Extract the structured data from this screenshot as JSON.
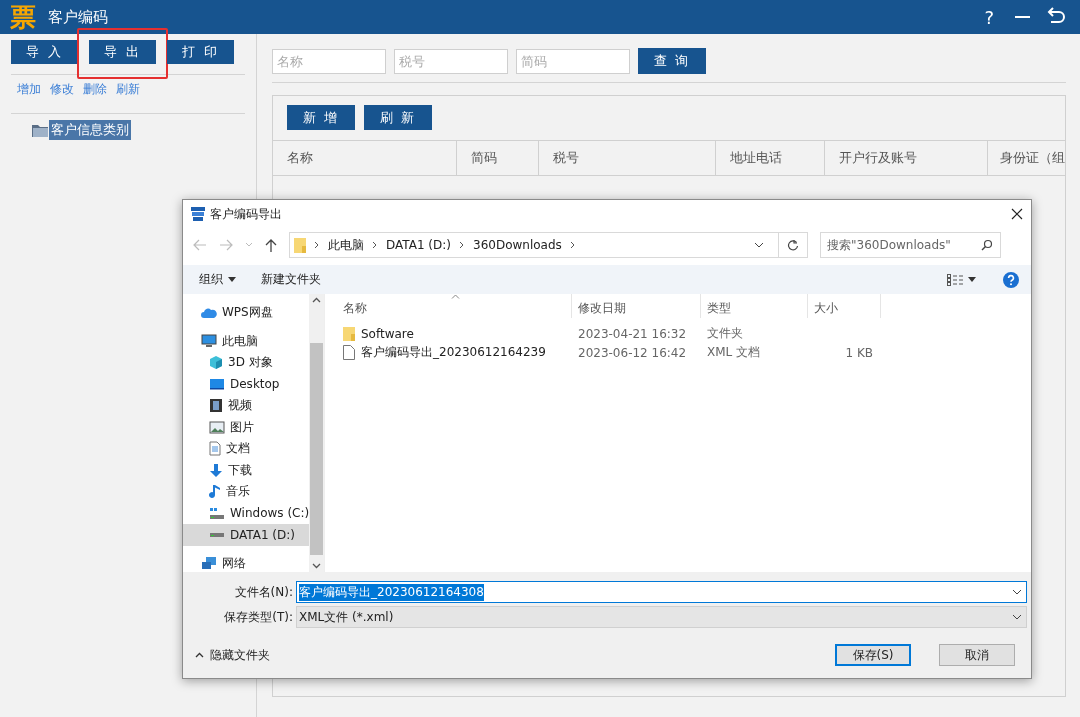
{
  "window": {
    "logo": "票",
    "title": "客户编码",
    "help": "?"
  },
  "toolbar": [
    {
      "label": "导 入",
      "highlighted": false
    },
    {
      "label": "导 出",
      "highlighted": true
    },
    {
      "label": "打 印",
      "highlighted": false
    }
  ],
  "tree_actions": [
    "增加",
    "修改",
    "删除",
    "刷新"
  ],
  "tree": [
    {
      "label": "客户信息类别",
      "selected": true
    }
  ],
  "search_fields": [
    {
      "placeholder": "名称"
    },
    {
      "placeholder": "税号"
    },
    {
      "placeholder": "简码"
    }
  ],
  "query_button": "查 询",
  "table_buttons": [
    "新 增",
    "刷 新"
  ],
  "table": {
    "columns": [
      "名称",
      "简码",
      "税号",
      "地址电话",
      "开户行及账号",
      "身份证（组"
    ]
  },
  "dialog": {
    "title": "客户编码导出",
    "breadcrumb": [
      "此电脑",
      "DATA1 (D:)",
      "360Downloads"
    ],
    "search": {
      "placeholder": "搜索\"360Downloads\""
    },
    "organize": "组织",
    "new_folder": "新建文件夹",
    "nav": [
      {
        "label": "WPS网盘",
        "selected": false
      },
      {
        "label": "此电脑",
        "selected": false,
        "children": [
          {
            "label": "3D 对象",
            "selected": false
          },
          {
            "label": "Desktop",
            "selected": false
          },
          {
            "label": "视频",
            "selected": false
          },
          {
            "label": "图片",
            "selected": false
          },
          {
            "label": "文档",
            "selected": false
          },
          {
            "label": "下载",
            "selected": false
          },
          {
            "label": "音乐",
            "selected": false
          },
          {
            "label": "Windows (C:)",
            "selected": false
          },
          {
            "label": "DATA1 (D:)",
            "selected": true
          }
        ]
      },
      {
        "label": "网络",
        "selected": false
      }
    ],
    "columns": [
      "名称",
      "修改日期",
      "类型",
      "大小"
    ],
    "files": [
      {
        "kind": "folder",
        "name": "Software",
        "modified": "2023-04-21 16:32",
        "type": "文件夹"
      },
      {
        "kind": "file",
        "name": "客户编码导出_20230612164239",
        "modified": "2023-06-12 16:42",
        "type": "XML 文档",
        "size": "1 KB"
      }
    ],
    "filename_label": "文件名(N):",
    "filename": "客户编码导出_20230612164308",
    "filetype_label": "保存类型(T):",
    "filetype": "XML文件 (*.xml)",
    "hide_folders": "隐藏文件夹",
    "buttons": [
      {
        "label": "保存(S)",
        "kind": "primary"
      },
      {
        "label": "取消",
        "kind": "normal"
      }
    ]
  }
}
